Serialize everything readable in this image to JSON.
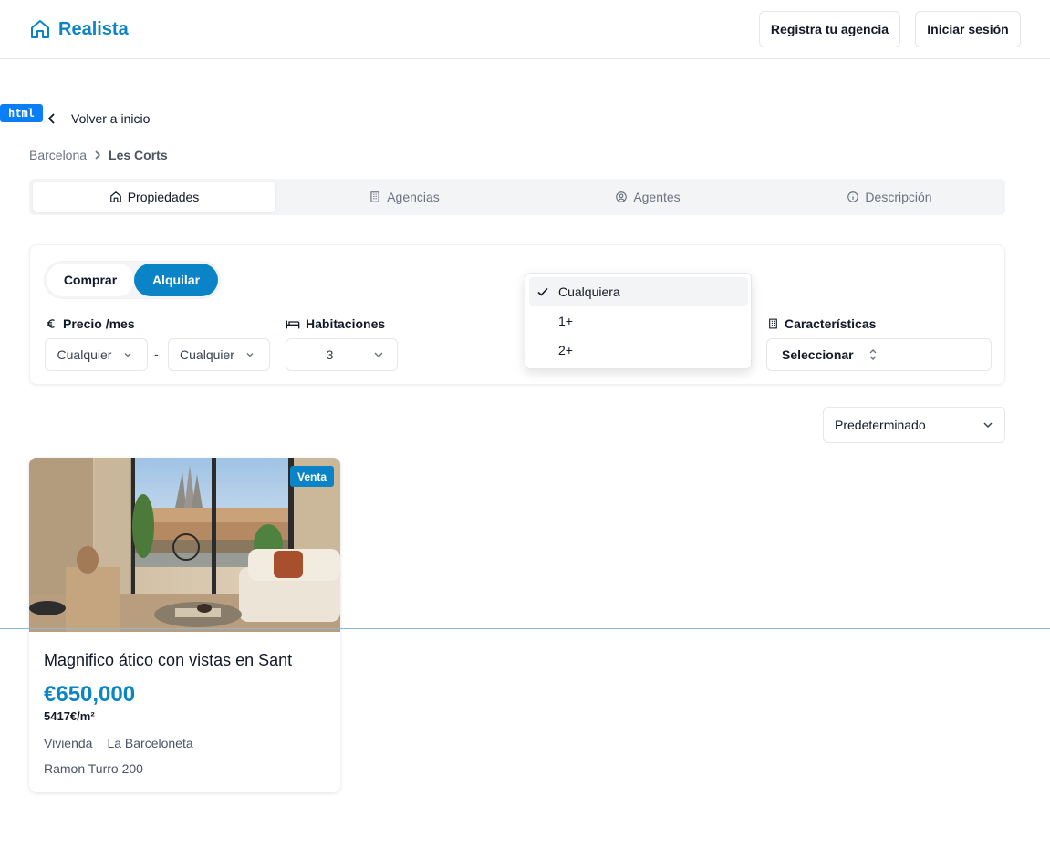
{
  "header": {
    "brand": "Realista",
    "register_agency": "Registra tu agencia",
    "login": "Iniciar sesión"
  },
  "badge_html": "html",
  "back_label": "Volver a inicio",
  "breadcrumb": {
    "city": "Barcelona",
    "district": "Les Corts"
  },
  "tabs": [
    {
      "label": "Propiedades",
      "icon": "home-icon",
      "active": true
    },
    {
      "label": "Agencias",
      "icon": "building-icon",
      "active": false
    },
    {
      "label": "Agentes",
      "icon": "user-circle-icon",
      "active": false
    },
    {
      "label": "Descripción",
      "icon": "info-icon",
      "active": false
    }
  ],
  "filters": {
    "mode_buy": "Comprar",
    "mode_rent": "Alquilar",
    "mode_selected": "Alquilar",
    "price_label": "Precio /mes",
    "price_min": "Cualquier",
    "price_max": "Cualquier",
    "price_separator": "-",
    "rooms_label": "Habitaciones",
    "rooms_value": "3",
    "features_label": "Características",
    "features_value": "Seleccionar"
  },
  "dropdown": {
    "options": [
      "Cualquiera",
      "1+",
      "2+"
    ],
    "selected": "Cualquiera"
  },
  "sort": {
    "value": "Predeterminado"
  },
  "listing": {
    "badge": "Venta",
    "title": "Magnifico ático con vistas en Sant",
    "price": "€650,000",
    "price_per_m2": "5417€/m²",
    "type": "Vivienda",
    "neighborhood": "La Barceloneta",
    "address": "Ramon Turro 200"
  },
  "colors": {
    "accent": "#0a84c6",
    "badge_html": "#0a7ef5"
  }
}
